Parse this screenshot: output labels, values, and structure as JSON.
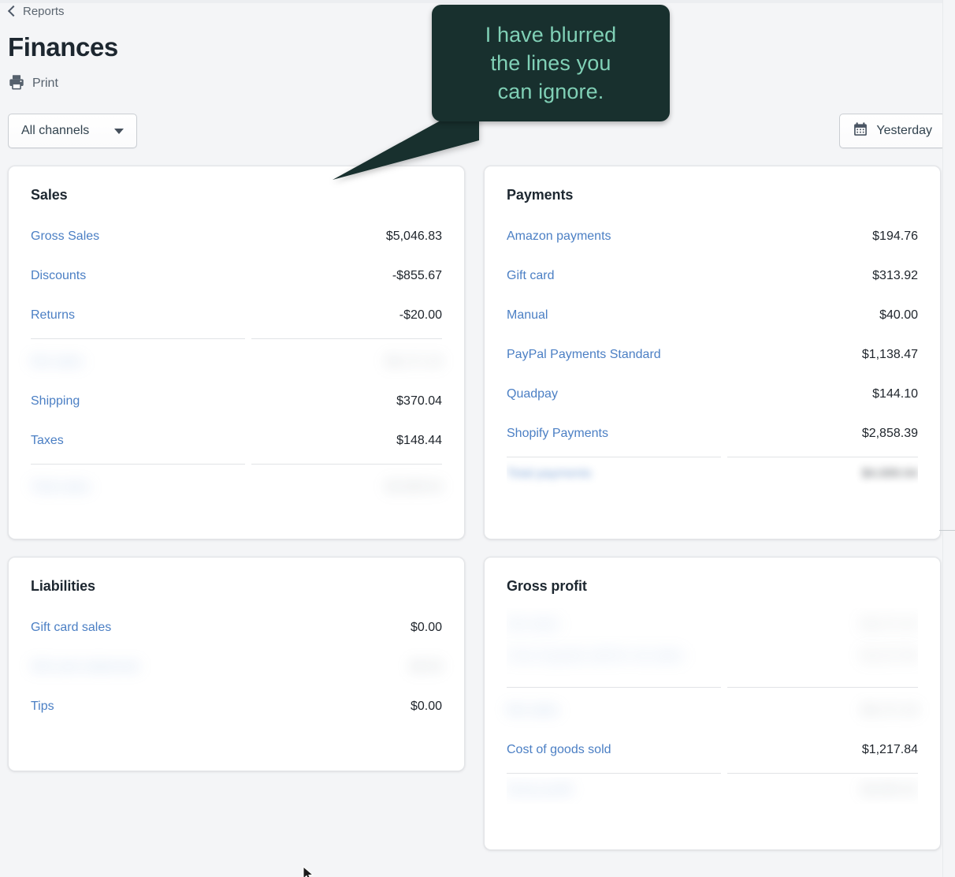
{
  "header": {
    "breadcrumb": "Reports",
    "title": "Finances",
    "print_label": "Print",
    "back_icon": "chevron-left-icon",
    "print_icon": "printer-icon"
  },
  "filters": {
    "channel_label": "All channels",
    "channel_caret_icon": "chevron-down-icon",
    "date_label": "Yesterday",
    "date_icon": "calendar-icon"
  },
  "annotation": {
    "text": "I have blurred\nthe lines you\ncan ignore.",
    "bubble_color": "#18302e",
    "text_color": "#80d0b6"
  },
  "colors": {
    "link": "#4b7fc4",
    "value": "#20262d",
    "page_bg": "#f4f5f7",
    "card_bg": "#ffffff",
    "divider": "#e1e3e6"
  },
  "cards": {
    "sales": {
      "title": "Sales",
      "rows": [
        {
          "label": "Gross Sales",
          "value": "$5,046.83",
          "state": "visible"
        },
        {
          "label": "Discounts",
          "value": "-$855.67",
          "state": "visible"
        },
        {
          "label": "Returns",
          "value": "-$20.00",
          "state": "visible"
        },
        {
          "label": "divider",
          "value": "",
          "state": "divider"
        },
        {
          "label": "Net sales",
          "value": "$4,171.16",
          "state": "blurred"
        },
        {
          "label": "Shipping",
          "value": "$370.04",
          "state": "visible"
        },
        {
          "label": "Taxes",
          "value": "$148.44",
          "state": "visible"
        },
        {
          "label": "divider",
          "value": "",
          "state": "divider"
        },
        {
          "label": "Total sales",
          "value": "$4,689.64",
          "state": "blurred"
        }
      ]
    },
    "payments": {
      "title": "Payments",
      "rows": [
        {
          "label": "Amazon payments",
          "value": "$194.76",
          "state": "visible"
        },
        {
          "label": "Gift card",
          "value": "$313.92",
          "state": "visible"
        },
        {
          "label": "Manual",
          "value": "$40.00",
          "state": "visible"
        },
        {
          "label": "PayPal Payments Standard",
          "value": "$1,138.47",
          "state": "visible"
        },
        {
          "label": "Quadpay",
          "value": "$144.10",
          "state": "visible"
        },
        {
          "label": "Shopify Payments",
          "value": "$2,858.39",
          "state": "visible"
        },
        {
          "label": "divider",
          "value": "",
          "state": "divider"
        },
        {
          "label": "Total payments",
          "value": "$4,689.64",
          "state": "blurred-soft"
        }
      ]
    },
    "liabilities": {
      "title": "Liabilities",
      "rows": [
        {
          "label": "Gift card sales",
          "value": "$0.00",
          "state": "visible"
        },
        {
          "label": "Gift card redeemed",
          "value": "$0.00",
          "state": "blurred"
        },
        {
          "label": "Tips",
          "value": "$0.00",
          "state": "visible"
        }
      ]
    },
    "gross_profit": {
      "title": "Gross profit",
      "blur_block": {
        "line_1_label": "Net sales",
        "line_2_label": "Cost of goods sold for net sales",
        "line_1_value": "$4,171.16",
        "line_2_value": "$1,217.84"
      },
      "rows": [
        {
          "label": "divider",
          "value": "",
          "state": "divider"
        },
        {
          "label": "Net sales",
          "value": "$4,171.16",
          "state": "blurred"
        },
        {
          "label": "Cost of goods sold",
          "value": "$1,217.84",
          "state": "visible"
        },
        {
          "label": "divider",
          "value": "",
          "state": "divider"
        },
        {
          "label": "Gross profit",
          "value": "$2,953.32",
          "state": "blurred"
        }
      ]
    }
  }
}
